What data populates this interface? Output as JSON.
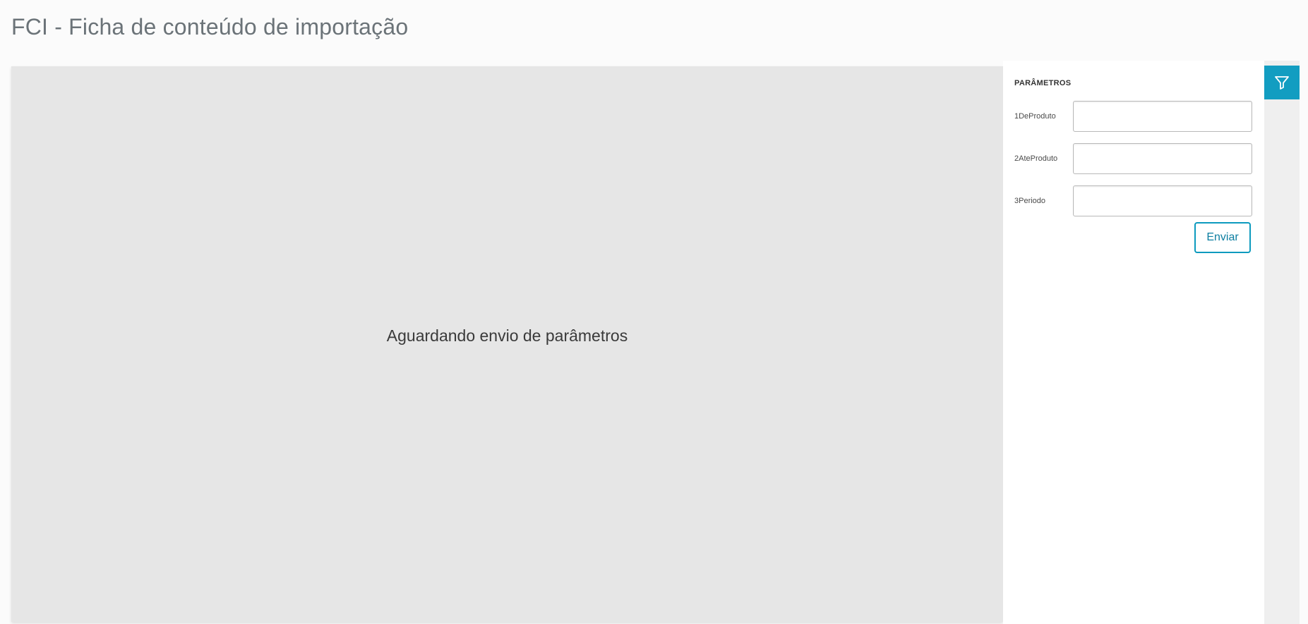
{
  "page": {
    "title": "FCI - Ficha de conteúdo de importação"
  },
  "viewer": {
    "message": "Aguardando envio de parâmetros"
  },
  "parameters": {
    "heading": "PARÂMETROS",
    "fields": [
      {
        "label": "1DeProduto",
        "value": ""
      },
      {
        "label": "2AteProduto",
        "value": ""
      },
      {
        "label": "3Periodo",
        "value": ""
      }
    ],
    "submit_label": "Enviar"
  },
  "toolbar": {
    "filter_icon": "filter-icon"
  },
  "colors": {
    "accent": "#129dc1",
    "button_border": "#0c9abe",
    "viewer_bg": "#e6e6e6"
  }
}
